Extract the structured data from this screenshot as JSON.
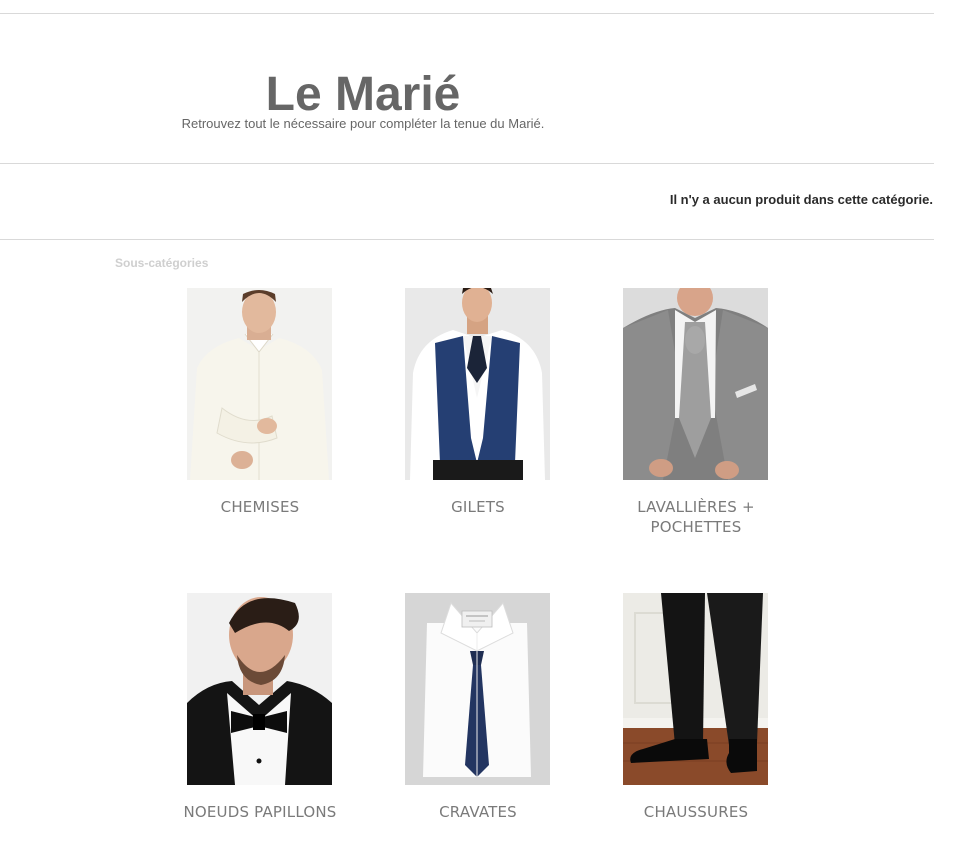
{
  "category": {
    "title": "Le Marié",
    "description": "Retrouvez tout le nécessaire pour compléter la tenue du Marié."
  },
  "products": {
    "empty_message": "Il n'y a aucun produit dans cette catégorie."
  },
  "subcategories": {
    "heading": "Sous-catégories",
    "items": [
      {
        "label": "CHEMISES",
        "icon": "white-shirt-photo"
      },
      {
        "label": "GILETS",
        "icon": "navy-vest-photo"
      },
      {
        "label": "LAVALLIÈRES + POCHETTES",
        "icon": "grey-cravat-photo"
      },
      {
        "label": "NOEUDS PAPILLONS",
        "icon": "bow-tie-photo"
      },
      {
        "label": "CRAVATES",
        "icon": "navy-tie-photo"
      },
      {
        "label": "CHAUSSURES",
        "icon": "black-shoes-photo"
      }
    ]
  }
}
